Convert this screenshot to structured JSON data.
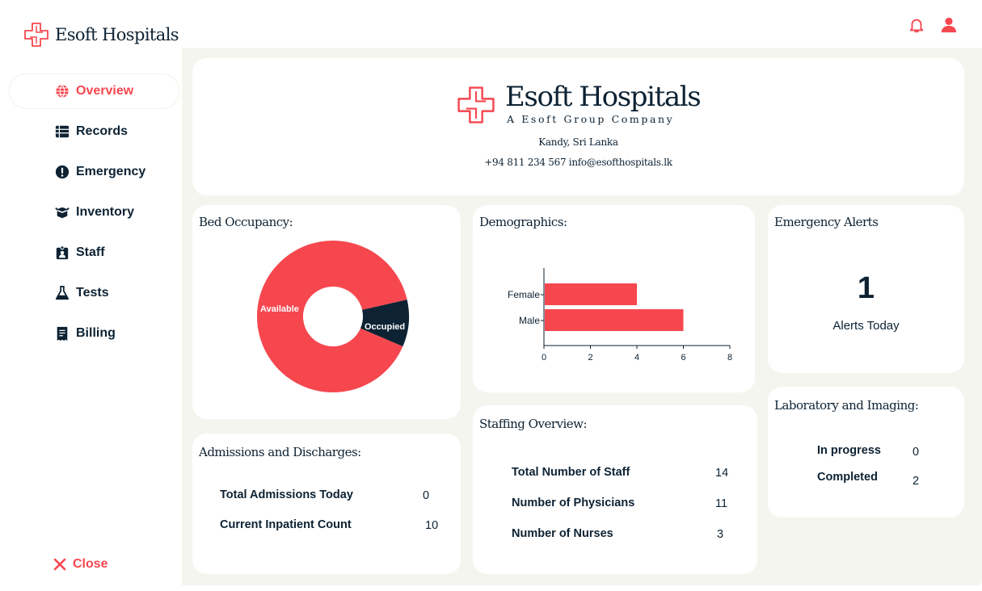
{
  "app": {
    "name": "Esoft Hospitals"
  },
  "header_icons": [
    "bell-icon",
    "user-icon"
  ],
  "sidebar": {
    "items": [
      {
        "label": "Overview",
        "icon": "globe-icon",
        "active": true
      },
      {
        "label": "Records",
        "icon": "table-icon",
        "active": false
      },
      {
        "label": "Emergency",
        "icon": "alert-circle-icon",
        "active": false
      },
      {
        "label": "Inventory",
        "icon": "box-icon",
        "active": false
      },
      {
        "label": "Staff",
        "icon": "id-badge-icon",
        "active": false
      },
      {
        "label": "Tests",
        "icon": "flask-icon",
        "active": false
      },
      {
        "label": "Billing",
        "icon": "receipt-icon",
        "active": false
      }
    ],
    "close_label": "Close"
  },
  "hero": {
    "name": "Esoft Hospitals",
    "tagline": "A Esoft Group Company",
    "location": "Kandy, Sri Lanka",
    "contact": "+94 811 234 567  info@esofthospitals.lk"
  },
  "bed_occupancy": {
    "title": "Bed Occupancy:"
  },
  "demographics": {
    "title": "Demographics:"
  },
  "emergency_alerts": {
    "title": "Emergency Alerts",
    "count": "1",
    "subtitle": "Alerts Today"
  },
  "admissions": {
    "title": "Admissions and Discharges:",
    "rows": [
      {
        "label": "Total Admissions Today",
        "value": "0"
      },
      {
        "label": "Current Inpatient Count",
        "value": "10"
      }
    ]
  },
  "staffing": {
    "title": "Staffing Overview:",
    "rows": [
      {
        "label": "Total Number of Staff",
        "value": "14"
      },
      {
        "label": "Number of Physicians",
        "value": "11"
      },
      {
        "label": "Number of Nurses",
        "value": "3"
      }
    ]
  },
  "lab": {
    "title": "Laboratory and Imaging:",
    "rows": [
      {
        "label": "In progress",
        "value": "0"
      },
      {
        "label": "Completed",
        "value": "2"
      }
    ]
  },
  "colors": {
    "accent": "#f6474f",
    "navy": "#0d2233",
    "panel_bg": "#f5f5f0"
  },
  "chart_data": [
    {
      "type": "pie",
      "categories": [
        "Available",
        "Occupied"
      ],
      "values": [
        90,
        10
      ],
      "colors": [
        "#f6474f",
        "#0d2233"
      ],
      "donut": true
    },
    {
      "type": "bar",
      "orientation": "horizontal",
      "categories": [
        "Female",
        "Male"
      ],
      "values": [
        4,
        6
      ],
      "xlim": [
        0,
        8
      ],
      "xticks": [
        "0",
        "2",
        "4",
        "6",
        "8"
      ],
      "colors": [
        "#f6474f"
      ]
    }
  ]
}
